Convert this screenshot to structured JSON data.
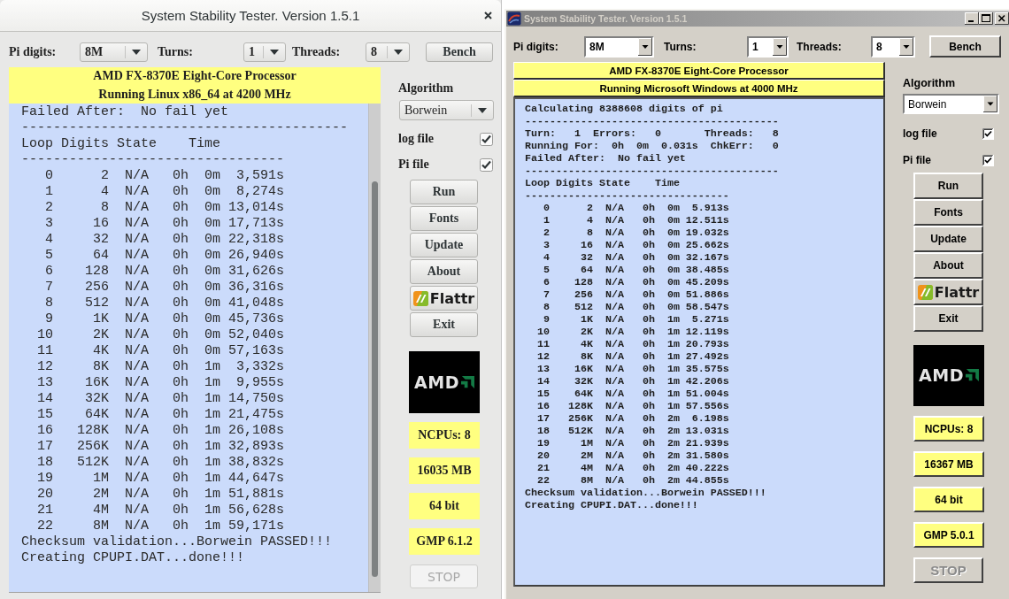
{
  "windows": [
    {
      "kind": "gtk",
      "title": "System Stability Tester. Version 1.5.1",
      "controls": [
        {
          "label": "Pi digits:",
          "value": "8M"
        },
        {
          "label": "Turns:",
          "value": "1"
        },
        {
          "label": "Threads:",
          "value": "8"
        }
      ],
      "bench_button": "Bench",
      "banner": [
        "AMD FX-8370E Eight-Core Processor",
        "Running Linux x86_64 at 4200 MHz"
      ],
      "log": [
        "Failed After:  No fail yet",
        "-----------------------------------------",
        "Loop Digits State    Time",
        "---------------------------------",
        "   0      2  N/A   0h  0m  3,591s",
        "   1      4  N/A   0h  0m  8,274s",
        "   2      8  N/A   0h  0m 13,014s",
        "   3     16  N/A   0h  0m 17,713s",
        "   4     32  N/A   0h  0m 22,318s",
        "   5     64  N/A   0h  0m 26,940s",
        "   6    128  N/A   0h  0m 31,626s",
        "   7    256  N/A   0h  0m 36,316s",
        "   8    512  N/A   0h  0m 41,048s",
        "   9     1K  N/A   0h  0m 45,736s",
        "  10     2K  N/A   0h  0m 52,040s",
        "  11     4K  N/A   0h  0m 57,163s",
        "  12     8K  N/A   0h  1m  3,332s",
        "  13    16K  N/A   0h  1m  9,955s",
        "  14    32K  N/A   0h  1m 14,750s",
        "  15    64K  N/A   0h  1m 21,475s",
        "  16   128K  N/A   0h  1m 26,108s",
        "  17   256K  N/A   0h  1m 32,893s",
        "  18   512K  N/A   0h  1m 38,832s",
        "  19     1M  N/A   0h  1m 44,647s",
        "  20     2M  N/A   0h  1m 51,881s",
        "  21     4M  N/A   0h  1m 56,628s",
        "  22     8M  N/A   0h  1m 59,171s",
        "Checksum validation...Borwein PASSED!!!",
        "Creating CPUPI.DAT...done!!!"
      ],
      "algorithm": {
        "label": "Algorithm",
        "value": "Borwein"
      },
      "options": [
        {
          "label": "log file",
          "checked": true
        },
        {
          "label": "Pi file",
          "checked": true
        }
      ],
      "buttons": [
        {
          "kind": "text",
          "label": "Run"
        },
        {
          "kind": "text",
          "label": "Fonts"
        },
        {
          "kind": "text",
          "label": "Update"
        },
        {
          "kind": "text",
          "label": "About"
        },
        {
          "kind": "logo",
          "label": "Flattr"
        },
        {
          "kind": "text",
          "label": "Exit"
        }
      ],
      "cpu_logo": "AMD",
      "info": [
        "NCPUs: 8",
        "16035 MB",
        "64 bit",
        "GMP 6.1.2"
      ],
      "stop_button": {
        "label": "STOP",
        "disabled": true
      }
    },
    {
      "kind": "classic",
      "title": "System Stability Tester. Version 1.5.1",
      "controls": [
        {
          "label": "Pi digits:",
          "value": "8M"
        },
        {
          "label": "Turns:",
          "value": "1"
        },
        {
          "label": "Threads:",
          "value": "8"
        }
      ],
      "bench_button": "Bench",
      "banner": [
        "AMD FX-8370E Eight-Core Processor",
        "Running Microsoft Windows at 4000 MHz"
      ],
      "log": [
        "Calculating 8388608 digits of pi",
        "-----------------------------------------",
        "Turn:   1  Errors:   0       Threads:   8",
        "Running For:  0h  0m  0.031s  ChkErr:   0",
        "Failed After:  No fail yet",
        "-----------------------------------------",
        "Loop Digits State    Time",
        "---------------------------------",
        "   0      2  N/A   0h  0m  5.913s",
        "   1      4  N/A   0h  0m 12.511s",
        "   2      8  N/A   0h  0m 19.032s",
        "   3     16  N/A   0h  0m 25.662s",
        "   4     32  N/A   0h  0m 32.167s",
        "   5     64  N/A   0h  0m 38.485s",
        "   6    128  N/A   0h  0m 45.209s",
        "   7    256  N/A   0h  0m 51.886s",
        "   8    512  N/A   0h  0m 58.547s",
        "   9     1K  N/A   0h  1m  5.271s",
        "  10     2K  N/A   0h  1m 12.119s",
        "  11     4K  N/A   0h  1m 20.793s",
        "  12     8K  N/A   0h  1m 27.492s",
        "  13    16K  N/A   0h  1m 35.575s",
        "  14    32K  N/A   0h  1m 42.206s",
        "  15    64K  N/A   0h  1m 51.004s",
        "  16   128K  N/A   0h  1m 57.556s",
        "  17   256K  N/A   0h  2m  6.198s",
        "  18   512K  N/A   0h  2m 13.031s",
        "  19     1M  N/A   0h  2m 21.939s",
        "  20     2M  N/A   0h  2m 31.580s",
        "  21     4M  N/A   0h  2m 40.222s",
        "  22     8M  N/A   0h  2m 44.855s",
        "Checksum validation...Borwein PASSED!!!",
        "Creating CPUPI.DAT...done!!!"
      ],
      "algorithm": {
        "label": "Algorithm",
        "value": "Borwein"
      },
      "options": [
        {
          "label": "log file",
          "checked": true
        },
        {
          "label": "Pi file",
          "checked": true
        }
      ],
      "buttons": [
        {
          "kind": "text",
          "label": "Run"
        },
        {
          "kind": "text",
          "label": "Fonts"
        },
        {
          "kind": "text",
          "label": "Update"
        },
        {
          "kind": "text",
          "label": "About"
        },
        {
          "kind": "logo",
          "label": "Flattr"
        },
        {
          "kind": "text",
          "label": "Exit"
        }
      ],
      "cpu_logo": "AMD",
      "info": [
        "NCPUs: 8",
        "16367 MB",
        "64 bit",
        "GMP 5.0.1"
      ],
      "stop_button": {
        "label": "STOP",
        "disabled": true
      }
    }
  ]
}
